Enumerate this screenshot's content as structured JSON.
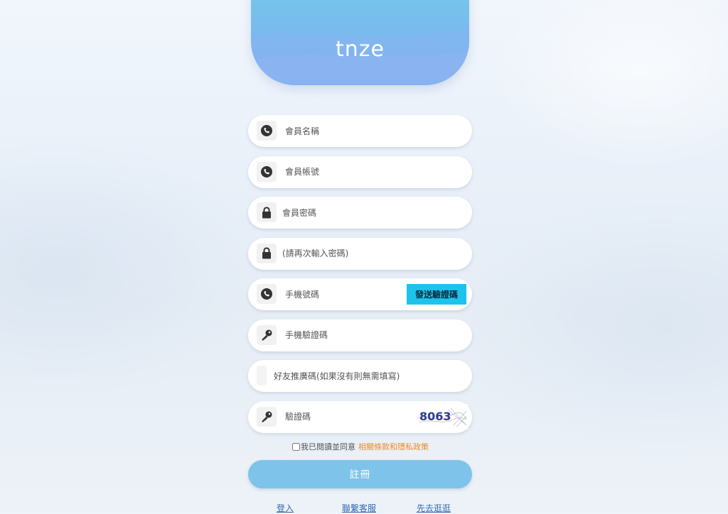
{
  "brand": {
    "logo_text": "tnze"
  },
  "form": {
    "fields": [
      {
        "name": "member-name",
        "placeholder": "會員名稱",
        "icon": "phone-icon"
      },
      {
        "name": "member-account",
        "placeholder": "會員帳號",
        "icon": "phone-icon"
      },
      {
        "name": "member-password",
        "placeholder": "會員密碼",
        "icon": "lock-icon"
      },
      {
        "name": "confirm-password",
        "placeholder": "(請再次輸入密碼)",
        "icon": "lock-icon"
      },
      {
        "name": "mobile-number",
        "placeholder": "手機號碼",
        "icon": "phone-icon"
      },
      {
        "name": "sms-code",
        "placeholder": "手機驗證碼",
        "icon": "key-icon"
      },
      {
        "name": "referral-code",
        "placeholder": "好友推廣碼(如果沒有則無需填寫)",
        "icon": ""
      },
      {
        "name": "captcha-code",
        "placeholder": "驗證碼",
        "icon": "key-icon"
      }
    ],
    "send_code_label": "發送驗證碼",
    "captcha_value": "8063",
    "agree_text": "我已閱讀並同意",
    "terms_link": "相關條款和隱私政策",
    "register_label": "註冊"
  },
  "footer_links": [
    "登入",
    "聯繫客服",
    "先去逛逛"
  ],
  "colors": {
    "header_top": "#74c6ea",
    "header_bottom": "#7aa8ee",
    "send_button": "#1ec3ec",
    "register_button": "#7ec3e9",
    "terms_link": "#e98b2a",
    "footer_link": "#2f6bb3"
  }
}
